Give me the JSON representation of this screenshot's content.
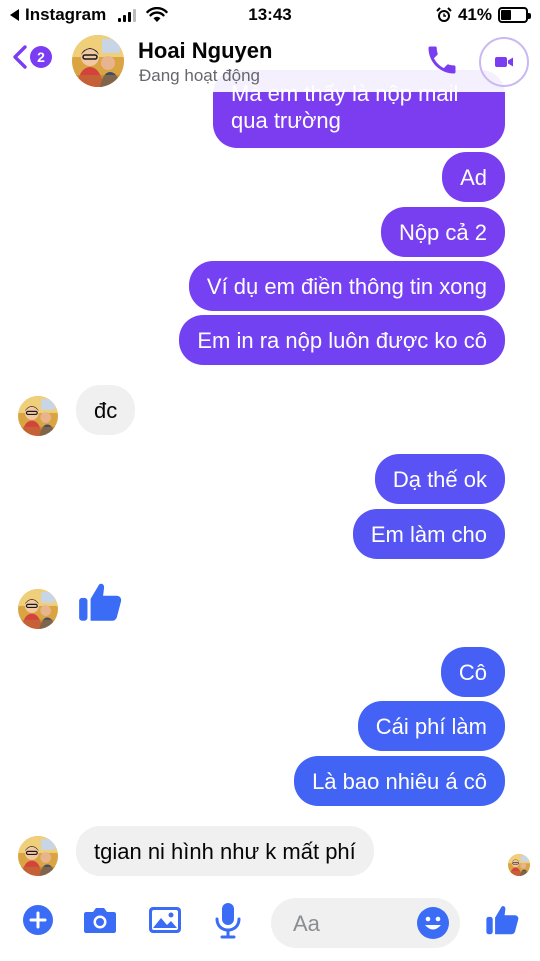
{
  "status_bar": {
    "back_app": "Instagram",
    "time": "13:43",
    "battery": "41%",
    "battery_level": 0.41
  },
  "header": {
    "unread_count": "2",
    "contact_name": "Hoai Nguyen",
    "contact_status": "Đang hoạt động",
    "call_icon": "phone-icon",
    "video_icon": "video-camera-icon"
  },
  "messages": {
    "out_partial": "Mà em thấy là nộp mail\nqua trường",
    "out_1": "Ad",
    "out_2": "Nộp cả 2",
    "out_3": "Ví dụ em điền thông tin xong",
    "out_4": "Em in ra nộp luôn được ko cô",
    "in_1": "đc",
    "out_5": "Dạ thế ok",
    "out_6": "Em làm cho",
    "in_2_icon": "thumbs-up-icon",
    "out_7": "Cô",
    "out_8": "Cái phí làm",
    "out_9": "Là bao nhiêu á cô",
    "in_3": "tgian ni hình như k mất phí"
  },
  "composer": {
    "placeholder": "Aa",
    "icons": [
      "plus-icon",
      "camera-icon",
      "image-icon",
      "microphone-icon",
      "emoji-icon",
      "thumbs-up-icon"
    ]
  },
  "colors": {
    "accent": "#7b3df2",
    "bubble_top": "#7d3cf0",
    "bubble_bottom": "#4161f5",
    "incoming": "#f0f0f0",
    "thumb": "#3b6cf6"
  }
}
